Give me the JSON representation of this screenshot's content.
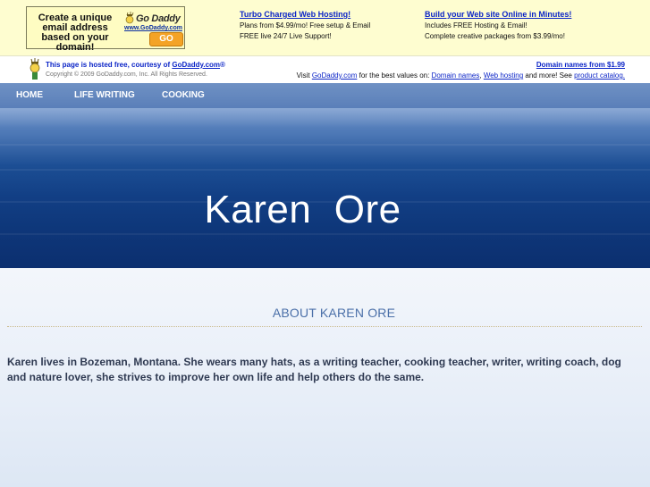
{
  "ad_banner": {
    "box_text": "Create a unique email address based on your domain!",
    "logo_text": "Go Daddy",
    "logo_url": "www.GoDaddy.com",
    "go_button": "GO",
    "col1": {
      "heading": "Turbo Charged Web Hosting!",
      "line1": "Plans from $4.99/mo! Free setup & Email",
      "line2": "FREE live 24/7 Live Support!"
    },
    "col2": {
      "heading": "Build your Web site Online in Minutes!",
      "line1": "Includes FREE Hosting & Email!",
      "line2": "Complete creative packages from $3.99/mo!"
    }
  },
  "hosted": {
    "prefix": "This page is hosted free, courtesy of ",
    "link": "GoDaddy.com",
    "suffix": "®",
    "copyright": "Copyright © 2009 GoDaddy.com, Inc. All Rights Reserved.",
    "domain_names": "Domain names from $1.99",
    "visit_prefix": "Visit ",
    "visit_link": "GoDaddy.com",
    "visit_mid": " for the best values on: ",
    "link_domains": "Domain names",
    "comma": ", ",
    "link_hosting": "Web hosting",
    "visit_more": " and more! See ",
    "link_catalog": "product catalog."
  },
  "nav": {
    "items": [
      "HOME",
      "LIFE WRITING",
      "COOKING"
    ]
  },
  "hero": {
    "title": "Karen  Ore"
  },
  "main": {
    "section_title": "ABOUT KAREN ORE",
    "about_text": "Karen lives in Bozeman, Montana. She wears many hats, as a  writing teacher, cooking teacher, writer, writing coach, dog and nature lover, she strives to improve her own life and help others do the same."
  },
  "colors": {
    "banner_bg": "#fefdd0",
    "link_blue": "#0c25c7",
    "nav_bg": "#6f91c4",
    "ocean_dark": "#0c2f6f",
    "section_title": "#4a6fa8"
  }
}
